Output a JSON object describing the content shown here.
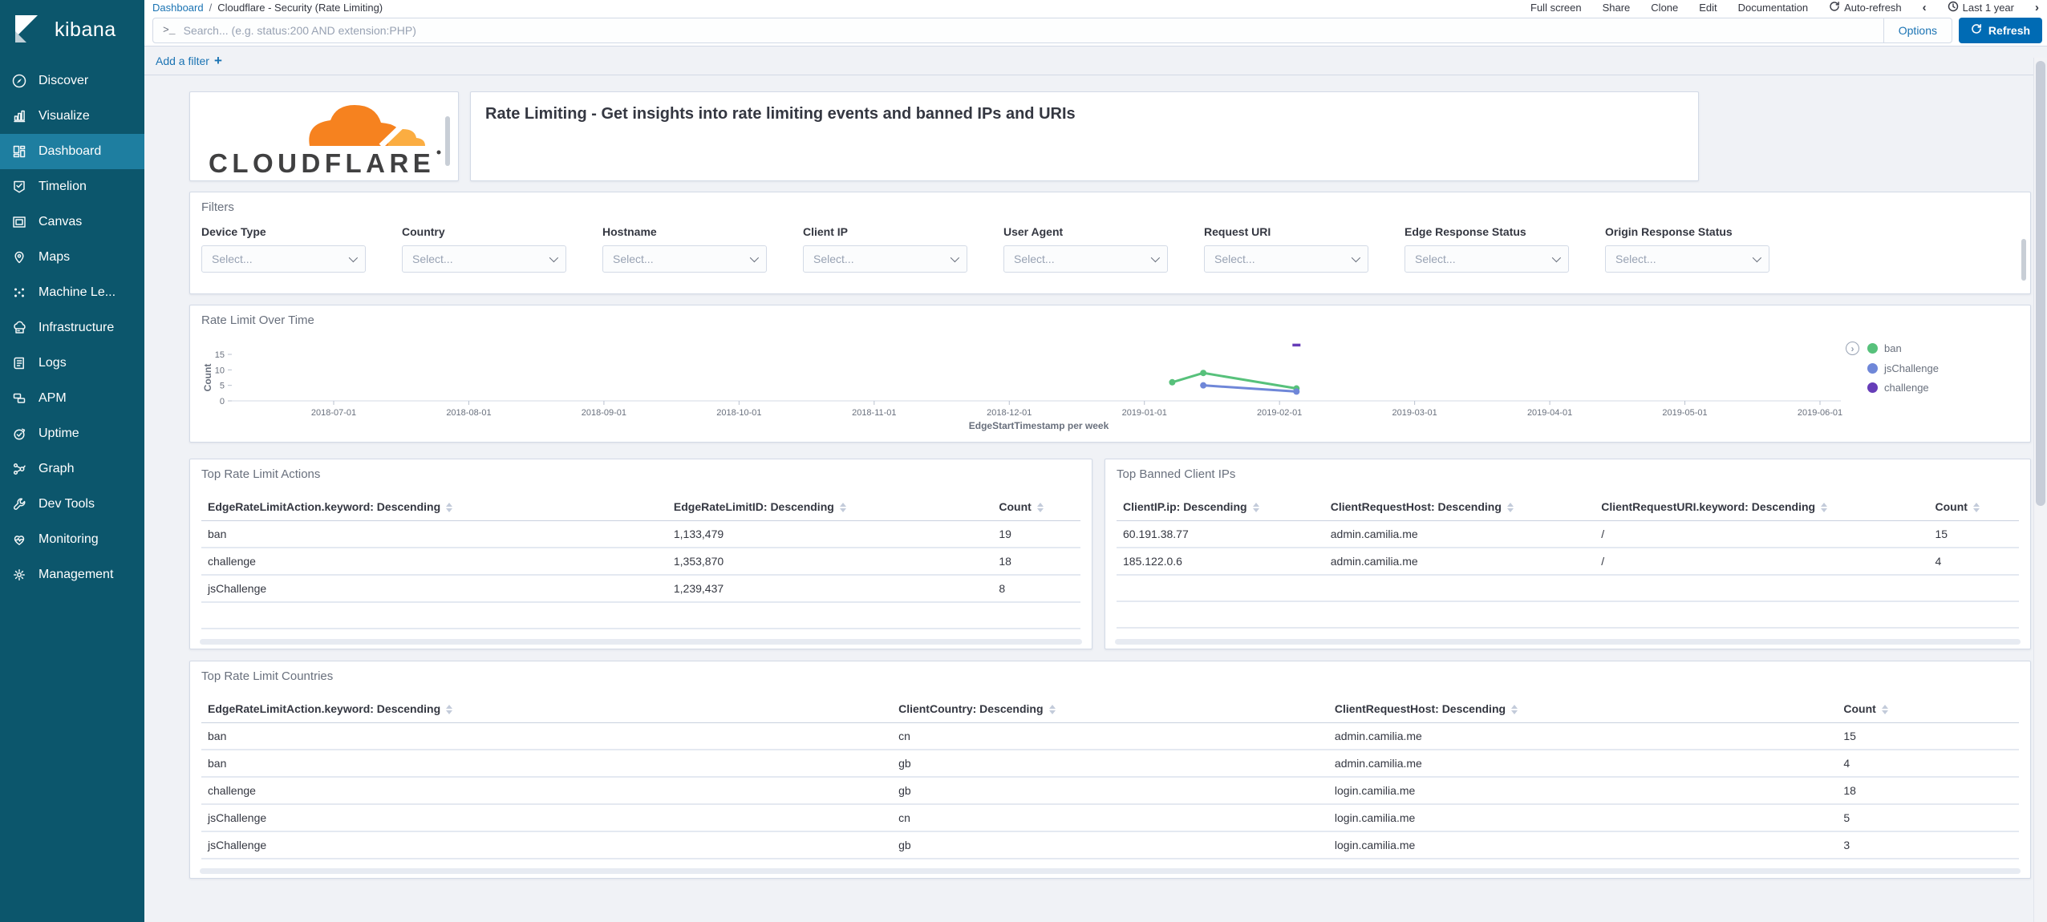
{
  "colors": {
    "sidebar_bg": "#0c566c",
    "sidebar_active": "#1e7ea0",
    "link_blue": "#1a73b3",
    "button_blue": "#006bb4",
    "text_dark": "#343741",
    "text_gray": "#69707d",
    "placeholder": "#98a2b3",
    "border": "#d3dae6",
    "page_bg": "#f0f2f6",
    "series_ban": "#57c17b",
    "series_jschallenge": "#6f87d8",
    "series_challenge": "#663db8",
    "cloudflare_orange": "#f6821f",
    "cloudflare_light_orange": "#fbad41"
  },
  "icons": {
    "prompt": ">_",
    "plus": "+",
    "chevron_left": "‹",
    "chevron_right": "›",
    "legend_toggle": "›",
    "names": [
      "kibana-logo",
      "discover-icon",
      "visualize-icon",
      "dashboard-icon",
      "timelion-icon",
      "canvas-icon",
      "maps-icon",
      "machine-learning-icon",
      "infrastructure-icon",
      "logs-icon",
      "apm-icon",
      "uptime-icon",
      "graph-icon",
      "dev-tools-icon",
      "monitoring-icon",
      "management-icon",
      "refresh-icon",
      "auto-refresh-icon",
      "clock-icon",
      "chevron-down-icon",
      "sort-icon",
      "cloudflare-cloud-icon"
    ]
  },
  "sidebar": {
    "logo_text": "kibana",
    "active_item": "Dashboard",
    "items": [
      {
        "label": "Discover"
      },
      {
        "label": "Visualize"
      },
      {
        "label": "Dashboard"
      },
      {
        "label": "Timelion"
      },
      {
        "label": "Canvas"
      },
      {
        "label": "Maps"
      },
      {
        "label": "Machine Le..."
      },
      {
        "label": "Infrastructure"
      },
      {
        "label": "Logs"
      },
      {
        "label": "APM"
      },
      {
        "label": "Uptime"
      },
      {
        "label": "Graph"
      },
      {
        "label": "Dev Tools"
      },
      {
        "label": "Monitoring"
      },
      {
        "label": "Management"
      }
    ]
  },
  "header": {
    "breadcrumb_root": "Dashboard",
    "breadcrumb_sep": "/",
    "breadcrumb_current": "Cloudflare - Security (Rate Limiting)",
    "menu": [
      "Full screen",
      "Share",
      "Clone",
      "Edit",
      "Documentation"
    ],
    "auto_refresh": "Auto-refresh",
    "time_range": "Last 1 year"
  },
  "search": {
    "placeholder": "Search... (e.g. status:200 AND extension:PHP)",
    "options_label": "Options",
    "refresh_label": "Refresh"
  },
  "filter_bar": {
    "add_filter": "Add a filter"
  },
  "dashboard": {
    "brand": "CLOUDFLARE",
    "description": "Rate Limiting - Get insights into rate limiting events and banned IPs and URIs",
    "filters": {
      "title": "Filters",
      "select_placeholder": "Select...",
      "fields": [
        "Device Type",
        "Country",
        "Hostname",
        "Client IP",
        "User Agent",
        "Request URI",
        "Edge Response Status",
        "Origin Response Status"
      ]
    },
    "tables": {
      "actions": {
        "title": "Top Rate Limit Actions",
        "headers": [
          "EdgeRateLimitAction.keyword: Descending",
          "EdgeRateLimitID: Descending",
          "Count"
        ],
        "rows": [
          [
            "ban",
            "1,133,479",
            "19"
          ],
          [
            "challenge",
            "1,353,870",
            "18"
          ],
          [
            "jsChallenge",
            "1,239,437",
            "8"
          ]
        ]
      },
      "banned": {
        "title": "Top Banned Client IPs",
        "headers": [
          "ClientIP.ip: Descending",
          "ClientRequestHost: Descending",
          "ClientRequestURI.keyword: Descending",
          "Count"
        ],
        "rows": [
          [
            "60.191.38.77",
            "admin.camilia.me",
            "/",
            "15"
          ],
          [
            "185.122.0.6",
            "admin.camilia.me",
            "/",
            "4"
          ]
        ]
      },
      "countries": {
        "title": "Top Rate Limit Countries",
        "headers": [
          "EdgeRateLimitAction.keyword: Descending",
          "ClientCountry: Descending",
          "ClientRequestHost: Descending",
          "Count"
        ],
        "rows": [
          [
            "ban",
            "cn",
            "admin.camilia.me",
            "15"
          ],
          [
            "ban",
            "gb",
            "admin.camilia.me",
            "4"
          ],
          [
            "challenge",
            "gb",
            "login.camilia.me",
            "18"
          ],
          [
            "jsChallenge",
            "cn",
            "login.camilia.me",
            "5"
          ],
          [
            "jsChallenge",
            "gb",
            "login.camilia.me",
            "3"
          ]
        ]
      }
    }
  },
  "chart_data": {
    "type": "line",
    "title": "Rate Limit Over Time",
    "xlabel": "EdgeStartTimestamp per week",
    "ylabel": "Count",
    "y_ticks": [
      0,
      5,
      10,
      15
    ],
    "ylim": [
      0,
      20
    ],
    "x_ticks": [
      "2018-07-01",
      "2018-08-01",
      "2018-09-01",
      "2018-10-01",
      "2018-11-01",
      "2018-12-01",
      "2019-01-01",
      "2019-02-01",
      "2019-03-01",
      "2019-04-01",
      "2019-05-01",
      "2019-06-01"
    ],
    "grid": false,
    "legend_position": "right",
    "series": [
      {
        "name": "ban",
        "color": "#57c17b",
        "points": [
          [
            "2019-01-06",
            6
          ],
          [
            "2019-01-13",
            9
          ],
          [
            "2019-02-03",
            4
          ]
        ]
      },
      {
        "name": "jsChallenge",
        "color": "#6f87d8",
        "points": [
          [
            "2019-01-13",
            5
          ],
          [
            "2019-02-03",
            3
          ]
        ]
      },
      {
        "name": "challenge",
        "color": "#663db8",
        "points": [
          [
            "2019-02-03",
            18
          ]
        ]
      }
    ]
  }
}
